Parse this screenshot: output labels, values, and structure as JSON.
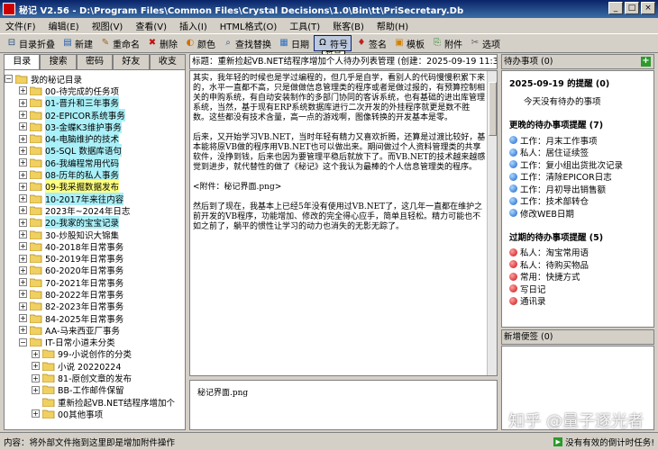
{
  "window": {
    "title": "秘记 V2.56 - D:\\Program Files\\Common Files\\Crystal Decisions\\1.0\\Bin\\tt\\PriSecretary.Db"
  },
  "menu": [
    "文件(F)",
    "编辑(E)",
    "视图(V)",
    "查看(V)",
    "插入(I)",
    "HTML格式(O)",
    "工具(T)",
    "账客(B)",
    "帮助(H)"
  ],
  "toolbar": {
    "items": [
      {
        "label": "目录折叠",
        "icon": "tree-collapse-icon"
      },
      {
        "label": "新建",
        "icon": "new-note-icon"
      },
      {
        "label": "重命名",
        "icon": "rename-icon"
      },
      {
        "label": "删除",
        "icon": "delete-icon"
      },
      {
        "label": "颜色",
        "icon": "color-icon"
      },
      {
        "label": "查找替换",
        "icon": "search-replace-icon"
      },
      {
        "label": "日期",
        "icon": "calendar-icon"
      },
      {
        "label": "符号",
        "icon": "omega-icon",
        "pressed": true
      },
      {
        "label": "签名",
        "icon": "pin-icon"
      },
      {
        "label": "模板",
        "icon": "template-icon"
      },
      {
        "label": "附件",
        "icon": "attachment-icon"
      },
      {
        "label": "选项",
        "icon": "tools-icon"
      }
    ],
    "tooltip": "符号"
  },
  "left_tabs": [
    "目录",
    "搜索",
    "密码",
    "好友",
    "收支"
  ],
  "tree": {
    "root": "我的秘记目录",
    "items": [
      {
        "label": "00-待完成的任务项",
        "style": "",
        "level": 1
      },
      {
        "label": "01-晋升和三年事务",
        "style": "hl-cyan",
        "level": 1
      },
      {
        "label": "02-EPICOR系统事务",
        "style": "hl-cyan",
        "level": 1
      },
      {
        "label": "03-金蝶K3维护事务",
        "style": "hl-cyan",
        "level": 1
      },
      {
        "label": "04-电脑维护的技术",
        "style": "hl-cyan",
        "level": 1
      },
      {
        "label": "05-SQL 数据库语句",
        "style": "hl-cyan",
        "level": 1
      },
      {
        "label": "06-我编程常用代码",
        "style": "hl-cyan",
        "level": 1
      },
      {
        "label": "08-历年的私人事务",
        "style": "hl-cyan",
        "level": 1
      },
      {
        "label": "09-我采掘数据发布",
        "style": "hl-yellow",
        "level": 1
      },
      {
        "label": "10-2017年来往内容",
        "style": "hl-cyan",
        "level": 1
      },
      {
        "label": "2023年~2024年日志",
        "style": "",
        "level": 1
      },
      {
        "label": "20-我家的宝宝记录",
        "style": "hl-cyan",
        "level": 1
      },
      {
        "label": "30-炒股知识大锦集",
        "style": "",
        "level": 1
      },
      {
        "label": "40-2018年日常事务",
        "style": "",
        "level": 1
      },
      {
        "label": "50-2019年日常事务",
        "style": "",
        "level": 1
      },
      {
        "label": "60-2020年日常事务",
        "style": "",
        "level": 1
      },
      {
        "label": "70-2021年日常事务",
        "style": "",
        "level": 1
      },
      {
        "label": "80-2022年日常事务",
        "style": "",
        "level": 1
      },
      {
        "label": "82-2023年日常事务",
        "style": "",
        "level": 1
      },
      {
        "label": "84-2025年日常事务",
        "style": "",
        "level": 1
      },
      {
        "label": "AA-马来西亚厂事务",
        "style": "",
        "level": 1
      },
      {
        "label": "IT-日常小道未分类",
        "style": "",
        "level": 1,
        "expanded": true
      },
      {
        "label": "99-小说创作的分类",
        "style": "",
        "level": 2
      },
      {
        "label": "小说 20220224",
        "style": "",
        "level": 2
      },
      {
        "label": "81-原创文章的发布",
        "style": "",
        "level": 2
      },
      {
        "label": "BB-工作邮件保留",
        "style": "",
        "level": 2
      },
      {
        "label": "重新捡起VB.NET结程序增加个",
        "style": "sel",
        "level": 2,
        "open": true
      },
      {
        "label": "00其他事项",
        "style": "",
        "level": 2
      }
    ]
  },
  "note": {
    "header": "标题：重新捡起VB.NET结程序增加个人待办列表管理  (创建：2025-09-19 11:37:1",
    "paragraphs": [
      "其实，我年轻的时候也是学过编程的，但几乎是自学，看别人的代码慢慢积累下来的，水平一直都不高，只是做做信息管理类的程序或者是做过报的，有预算控制相关的申购系统，有自动安装制作的多部门协同的客诉系统，也有基础的进出库管理系统，当然，基于现有ERP系统数据库进行二次开发的外挂程序就更是数不胜数。这些都没有技术含量，高一点的游戏啊，图像转换的开发基本是零。",
      "后来，又开始学习VB.NET，当时年轻有精力又喜欢折腾，还算是过渡比较好，基本能将原VB做的程序用VB.NET也可以做出来。期间做过个人资料管理类的共享软件，没挣到钱，后来也因为要管理平稳后就放下了。而VB.NET的技术越来越感觉到进步，就代替性的做了《秘记》这个我认为最棒的个人信息管理类的程序。",
      "<附件：秘记界面.png>",
      "然后到了现在，我基本上已经5年没有使用过VB.NET了，这几年一直都在维护之前开发的VB程序，功能增加、修改的完全得心应手，简单且轻松。精力可能也不如之前了，躺平的惯性让学习的动力也消失的无影无踪了。"
    ],
    "attachment": "秘记界面.png"
  },
  "todo": {
    "header": "待办事项 (0)",
    "today_title": "2025-09-19 的提醒 (0)",
    "today_empty": "今天没有待办的事项",
    "upcoming_title": "更晚的待办事项提醒 (7)",
    "upcoming": [
      "工作：月末工作事项",
      "私人：居住证续签",
      "工作：复小组出货批次记录",
      "工作：清除EPICOR日志",
      "工作：月初导出销售额",
      "工作：技术部转仓",
      "修改WEB日期"
    ],
    "overdue_title": "过期的待办事项提醒 (5)",
    "overdue": [
      "私人：淘宝常用语",
      "私人：待购买物品",
      "常用：快捷方式",
      "写日记",
      "通讯录"
    ]
  },
  "memo": {
    "header": "新增便签 (0)"
  },
  "status": {
    "left": "内容：将外部文件拖到这里即是增加附件操作",
    "right": "没有有效的倒计时任务!"
  },
  "watermark": "知乎 @量子逐光者"
}
